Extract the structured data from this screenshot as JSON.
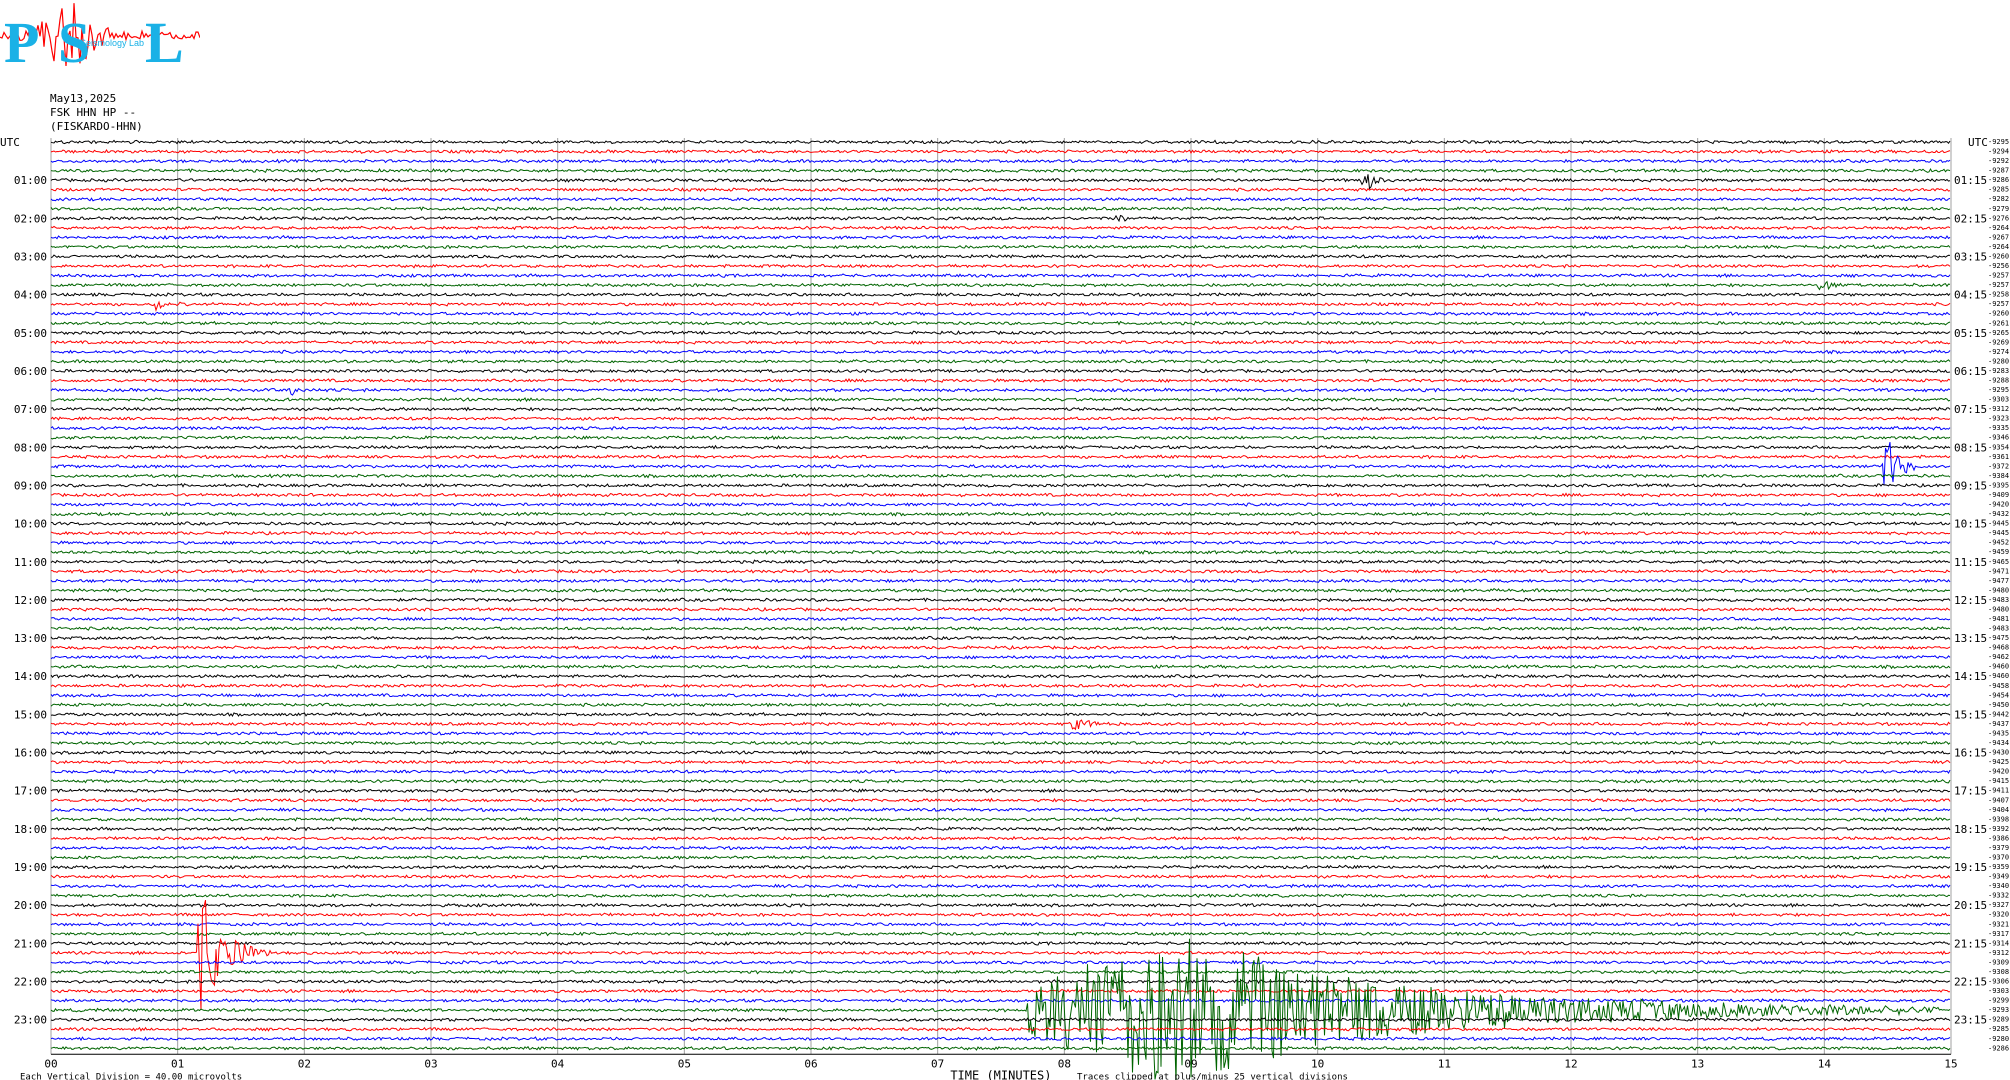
{
  "logo": {
    "letters": [
      "P",
      "S",
      "L"
    ],
    "tagline": "Seismology Lab",
    "colors": {
      "letters": "#1ab1e6",
      "trace": "#ff0000"
    }
  },
  "header": {
    "date": "May13,2025",
    "station": "FSK HHN HP --",
    "site": "(FISKARDO-HHN)"
  },
  "chart_data": {
    "type": "line",
    "title": "",
    "left_axis_title": "UTC",
    "right_axis_title": "UTC",
    "xlabel": "TIME (MINUTES)",
    "x_ticks": [
      "00",
      "01",
      "02",
      "03",
      "04",
      "05",
      "06",
      "07",
      "08",
      "09",
      "10",
      "11",
      "12",
      "13",
      "14",
      "15"
    ],
    "xlim": [
      0,
      15
    ],
    "grid": true,
    "hour_labels_left": [
      "01:00",
      "02:00",
      "03:00",
      "04:00",
      "05:00",
      "06:00",
      "07:00",
      "08:00",
      "09:00",
      "10:00",
      "11:00",
      "12:00",
      "13:00",
      "14:00",
      "15:00",
      "16:00",
      "17:00",
      "18:00",
      "19:00",
      "20:00",
      "21:00",
      "22:00",
      "23:00"
    ],
    "hour_labels_right": [
      "01:15",
      "02:15",
      "03:15",
      "04:15",
      "05:15",
      "06:15",
      "07:15",
      "08:15",
      "09:15",
      "10:15",
      "11:15",
      "12:15",
      "13:15",
      "14:15",
      "15:15",
      "16:15",
      "17:15",
      "18:15",
      "19:15",
      "20:15",
      "21:15",
      "22:15",
      "23:15"
    ],
    "trace_colors": [
      "#000000",
      "#ff0000",
      "#0000ff",
      "#006400"
    ],
    "trace_count": 96,
    "right_offsets": [
      -9295,
      -9294,
      -9292,
      -9287,
      -9286,
      -9285,
      -9282,
      -9279,
      -9276,
      -9264,
      -9267,
      -9264,
      -9260,
      -9256,
      -9257,
      -9257,
      -9258,
      -9257,
      -9260,
      -9261,
      -9265,
      -9269,
      -9274,
      -9280,
      -9283,
      -9288,
      -9295,
      -9303,
      -9312,
      -9323,
      -9335,
      -9346,
      -9354,
      -9361,
      -9372,
      -9384,
      -9395,
      -9409,
      -9420,
      -9432,
      -9445,
      -9445,
      -9452,
      -9459,
      -9465,
      -9471,
      -9477,
      -9480,
      -9483,
      -9480,
      -9481,
      -9483,
      -9475,
      -9468,
      -9462,
      -9460,
      -9460,
      -9458,
      -9454,
      -9450,
      -9442,
      -9437,
      -9435,
      -9434,
      -9430,
      -9425,
      -9420,
      -9415,
      -9411,
      -9407,
      -9404,
      -9398,
      -9392,
      -9386,
      -9379,
      -9370,
      -9359,
      -9349,
      -9340,
      -9332,
      -9327,
      -9320,
      -9321,
      -9317,
      -9314,
      -9312,
      -9309,
      -9308,
      -9306,
      -9303,
      -9299,
      -9293,
      -9289,
      -9285,
      -9280,
      -9286
    ],
    "events": [
      {
        "row": 4,
        "minute": 10.35,
        "amplitude": 12,
        "duration": 0.25
      },
      {
        "row": 8,
        "minute": 8.4,
        "amplitude": 5,
        "duration": 0.15
      },
      {
        "row": 15,
        "minute": 13.95,
        "amplitude": 8,
        "duration": 0.3
      },
      {
        "row": 17,
        "minute": 0.8,
        "amplitude": 7,
        "duration": 0.25
      },
      {
        "row": 26,
        "minute": 1.88,
        "amplitude": 6,
        "duration": 0.1
      },
      {
        "row": 34,
        "minute": 14.45,
        "amplitude": 40,
        "duration": 0.3
      },
      {
        "row": 61,
        "minute": 8.05,
        "amplitude": 8,
        "duration": 0.5
      },
      {
        "row": 85,
        "minute": 1.15,
        "amplitude": 70,
        "duration": 0.6
      },
      {
        "row": 91,
        "minute": 7.7,
        "amplitude": 80,
        "duration": 7.2,
        "peak_minute": 8.9
      }
    ],
    "notes": {
      "vertical_division": "Each Vertical Division =    40.00 microvolts",
      "clipping": "Traces clipped at plus/minus 25 vertical divisions"
    }
  }
}
